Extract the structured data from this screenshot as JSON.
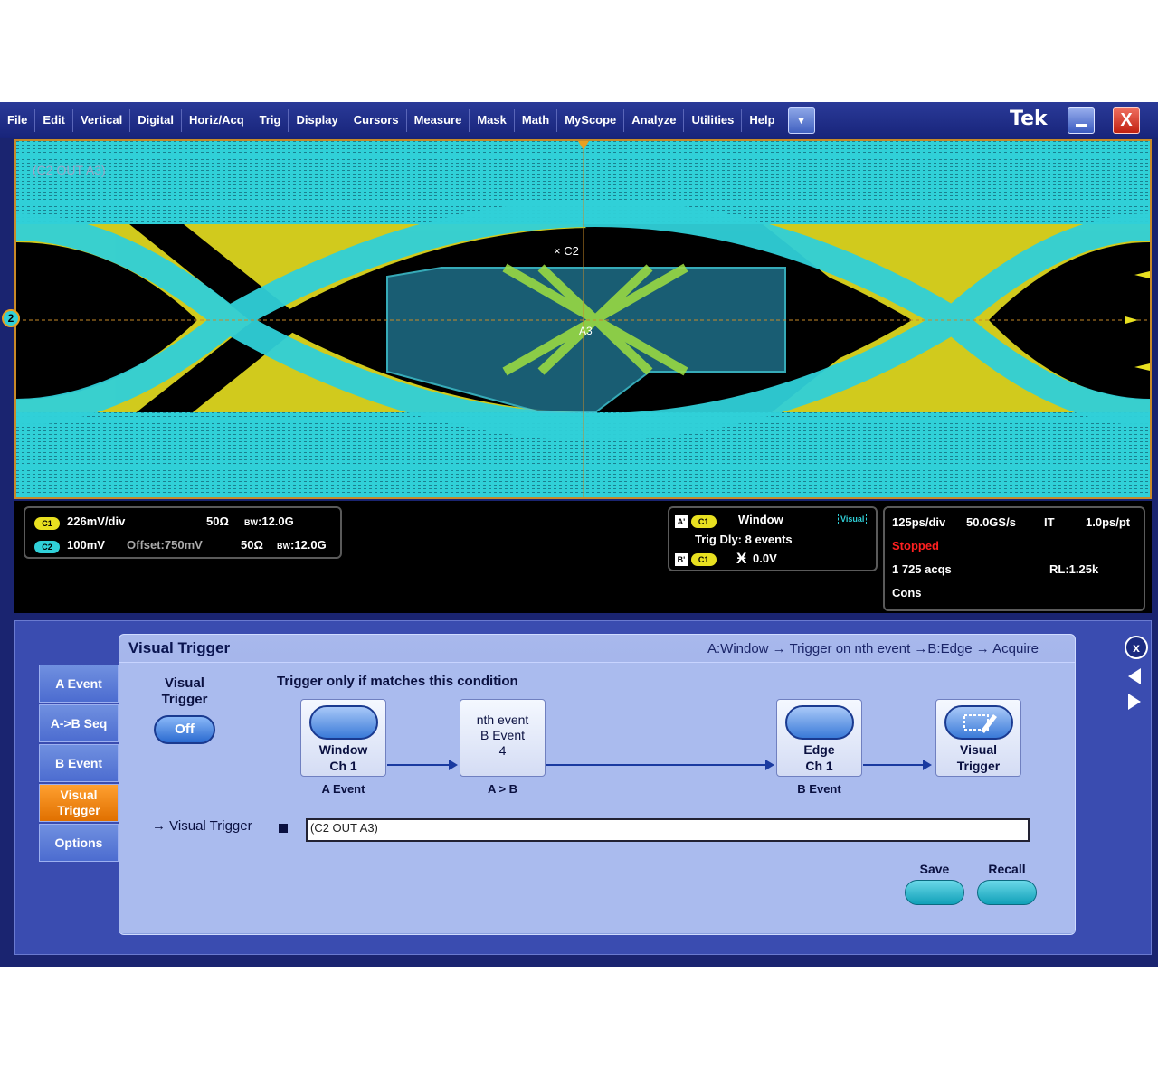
{
  "menu": {
    "items": [
      "File",
      "Edit",
      "Vertical",
      "Digital",
      "Horiz/Acq",
      "Trig",
      "Display",
      "Cursors",
      "Measure",
      "Mask",
      "Math",
      "MyScope",
      "Analyze",
      "Utilities",
      "Help"
    ],
    "brand": "Tek",
    "close_glyph": "X"
  },
  "graticule": {
    "waveform_label": "(C2 OUT A3)",
    "cursor_c2_label": "C2",
    "cursor_a3_label": "A3",
    "channel_marker": "2",
    "colors": {
      "ch1": "#e8e020",
      "ch2": "#30d0d8",
      "mask": "#1e6e88",
      "border": "#c88a28"
    }
  },
  "readouts": {
    "ch1": {
      "badge": "C1",
      "scale": "226mV/div",
      "impedance": "50Ω",
      "bandwidth": "12.0G"
    },
    "ch2": {
      "badge": "C2",
      "scale": "100mV",
      "offset": "Offset:750mV",
      "impedance": "50Ω",
      "bandwidth": "12.0G"
    },
    "bw_prefix": "BW",
    "trigger": {
      "a_badge": "A'",
      "a_ch": "C1",
      "a_type": "Window",
      "delay": "Trig Dly: 8 events",
      "b_badge": "B'",
      "b_ch": "C1",
      "b_level": "0.0V",
      "visual_tag": "Visual"
    },
    "acq": {
      "timebase": "125ps/div",
      "sample_rate": "50.0GS/s",
      "mode": "IT",
      "resolution": "1.0ps/pt",
      "state": "Stopped",
      "acqs": "1 725 acqs",
      "record_length": "RL:1.25k",
      "cons": "Cons"
    }
  },
  "side_tabs": [
    "A Event",
    "A->B Seq",
    "B Event",
    "Visual Trigger",
    "Options"
  ],
  "dialog": {
    "title": "Visual Trigger",
    "path": "A:Window → Trigger on nth event →B:Edge → Acquire",
    "vt_label": "Visual Trigger",
    "vt_button": "Off",
    "condition_heading": "Trigger only if matches this condition",
    "nodes": [
      {
        "line1": "Window",
        "line2": "Ch 1",
        "caption": "A Event"
      },
      {
        "line1": "nth event",
        "line2": "B Event",
        "line3": "4",
        "caption": "A > B"
      },
      {
        "line1": "Edge",
        "line2": "Ch 1",
        "caption": "B Event"
      },
      {
        "line1": "Visual",
        "line2": "Trigger",
        "caption": ""
      }
    ],
    "expr_label": "→ Visual Trigger",
    "expr_value": "(C2 OUT A3)",
    "save_label": "Save",
    "recall_label": "Recall"
  }
}
